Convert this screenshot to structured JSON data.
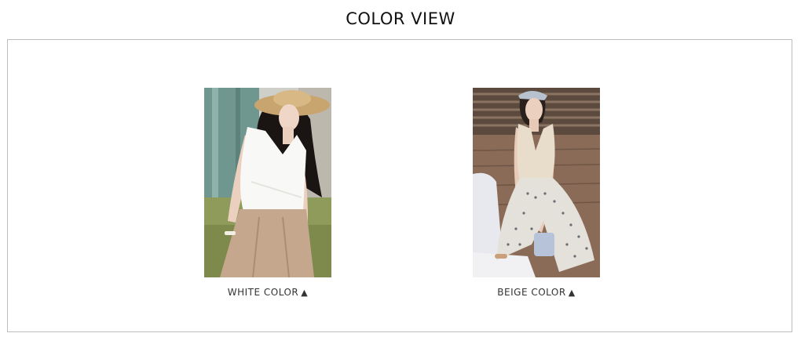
{
  "page_title": "COLOR VIEW",
  "colors": [
    {
      "label": "WHITE COLOR",
      "arrow": "▲"
    },
    {
      "label": "BEIGE COLOR",
      "arrow": "▲"
    }
  ]
}
